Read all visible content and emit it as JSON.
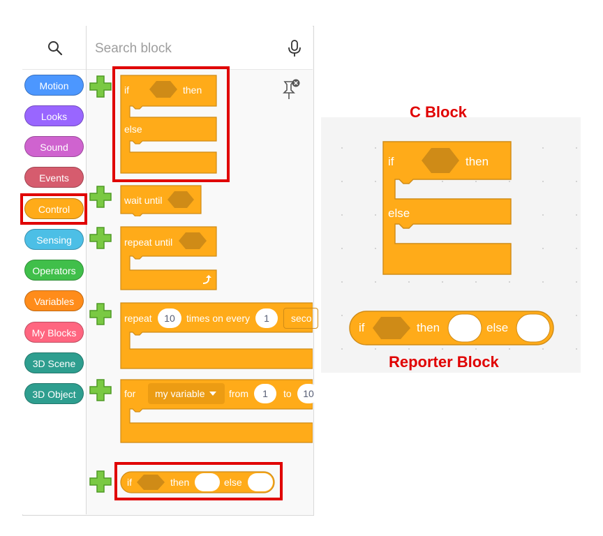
{
  "search": {
    "placeholder": "Search block"
  },
  "categories": [
    {
      "label": "Motion",
      "color": "#4c97ff"
    },
    {
      "label": "Looks",
      "color": "#9966ff"
    },
    {
      "label": "Sound",
      "color": "#cf63cf"
    },
    {
      "label": "Events",
      "color": "#d65c6e"
    },
    {
      "label": "Control",
      "color": "#ffab19"
    },
    {
      "label": "Sensing",
      "color": "#4cbfe6"
    },
    {
      "label": "Operators",
      "color": "#40bf4a"
    },
    {
      "label": "Variables",
      "color": "#ff8c1a"
    },
    {
      "label": "My Blocks",
      "color": "#ff6680"
    },
    {
      "label": "3D Scene",
      "color": "#2e9e8f"
    },
    {
      "label": "3D Object",
      "color": "#2e9e8f"
    }
  ],
  "blocks": {
    "if_else": {
      "if": "if",
      "then": "then",
      "else": "else"
    },
    "wait_until": {
      "label": "wait until"
    },
    "repeat_until": {
      "label": "repeat until"
    },
    "repeat": {
      "label": "repeat",
      "count": "10",
      "middle": "times on every",
      "interval": "1",
      "unit": "seco"
    },
    "for": {
      "label": "for",
      "variable": "my variable",
      "from": "from",
      "from_value": "1",
      "to": "to",
      "to_value": "10"
    },
    "reporter": {
      "if": "if",
      "then": "then",
      "else": "else"
    }
  },
  "annotations": {
    "c_block_title": "C Block",
    "reporter_block_title": "Reporter Block"
  },
  "colors": {
    "control": "#ffab19",
    "control_dark": "#cf8b17",
    "highlight": "#e00000",
    "plus_green": "#7ac943"
  }
}
